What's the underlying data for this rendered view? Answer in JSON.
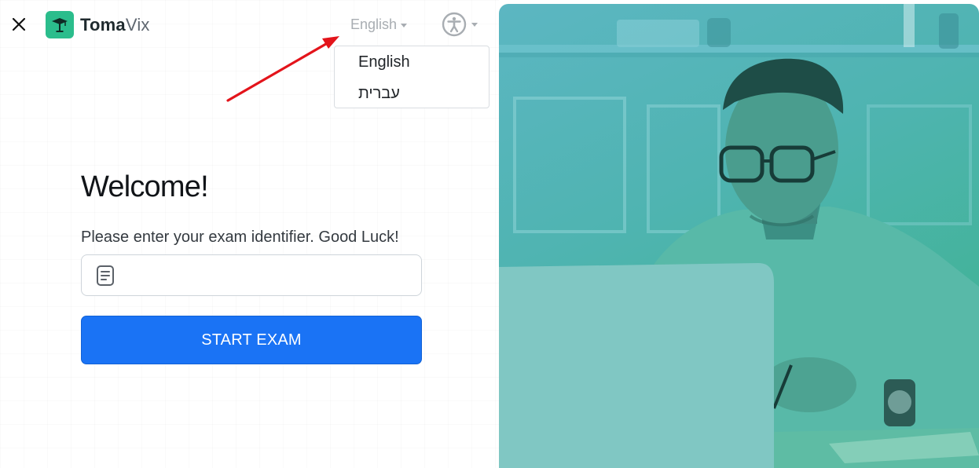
{
  "app": {
    "brand_part1": "Toma",
    "brand_part2": "Vix"
  },
  "header": {
    "close_icon": "close-icon",
    "logo_icon": "graduation-cap-icon",
    "language": {
      "selected": "English",
      "options": [
        "English",
        "עברית"
      ]
    },
    "accessibility_icon": "accessibility-icon"
  },
  "main": {
    "title": "Welcome!",
    "instruction": "Please enter your exam identifier. Good Luck!",
    "input": {
      "value": "",
      "placeholder": "",
      "icon": "document-icon"
    },
    "start_button": "START EXAM"
  },
  "colors": {
    "accent": "#1a73f5",
    "brand": "#2bbd8c",
    "annotation_arrow": "#e3141b",
    "hero_tint": "#4fb4b1"
  }
}
